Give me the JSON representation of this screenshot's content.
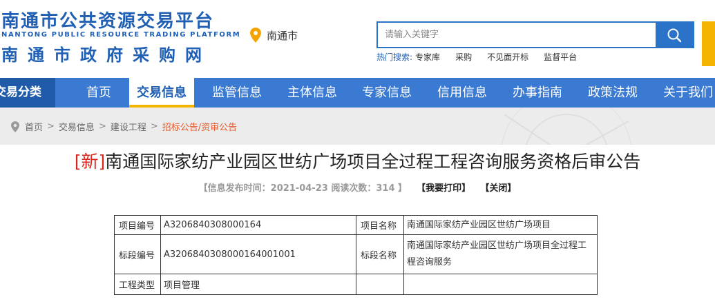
{
  "header": {
    "logo_cn": "南通市公共资源交易平台",
    "logo_en": "NANTONG PUBLIC RESOURCE TRADING PLATFORM",
    "logo_sub": "南通市政府采购网",
    "location": "南通市",
    "search": {
      "placeholder": "请输入关键字"
    },
    "hot_search": {
      "label": "热门搜索:",
      "links": [
        "专家库",
        "采购",
        "不见面开标",
        "监督平台"
      ]
    }
  },
  "nav": {
    "category_label": "交易分类",
    "items": [
      "首页",
      "交易信息",
      "监管信息",
      "主体信息",
      "专家信息",
      "信用信息",
      "办事指南",
      "政策法规",
      "关于我们"
    ],
    "active": "交易信息"
  },
  "breadcrumb": {
    "items": [
      "首页",
      "交易信息",
      "建设工程"
    ],
    "current": "招标公告/资审公告",
    "separator": ">"
  },
  "article": {
    "tag": "[新]",
    "title": "南通国际家纺产业园区世纺广场项目全过程工程咨询服务资格后审公告",
    "meta_prefix": "【信息发布时间：2021-04-23 阅读次数：314 】",
    "print_link": "【我要打印】",
    "close_link": "【关闭】"
  },
  "table": {
    "rows": [
      {
        "label1": "项目编号",
        "value1": "A3206840308000164",
        "label2": "项目名称",
        "value2": "南通国际家纺产业园区世纺广场项目"
      },
      {
        "label1": "标段编号",
        "value1": "A3206840308000164001001",
        "label2": "标段名称",
        "value2": "南通国际家纺产业园区世纺广场项目全过程工程咨询服务"
      },
      {
        "label1": "工程类型",
        "value1": "项目管理",
        "label2": "",
        "value2": ""
      }
    ]
  },
  "colors": {
    "brand_blue": "#1f5fb4",
    "nav_blue": "#3a7ad2",
    "accent_yellow": "#f5b400",
    "tag_red": "#d9251c",
    "crumb_orange": "#e25a2b"
  }
}
